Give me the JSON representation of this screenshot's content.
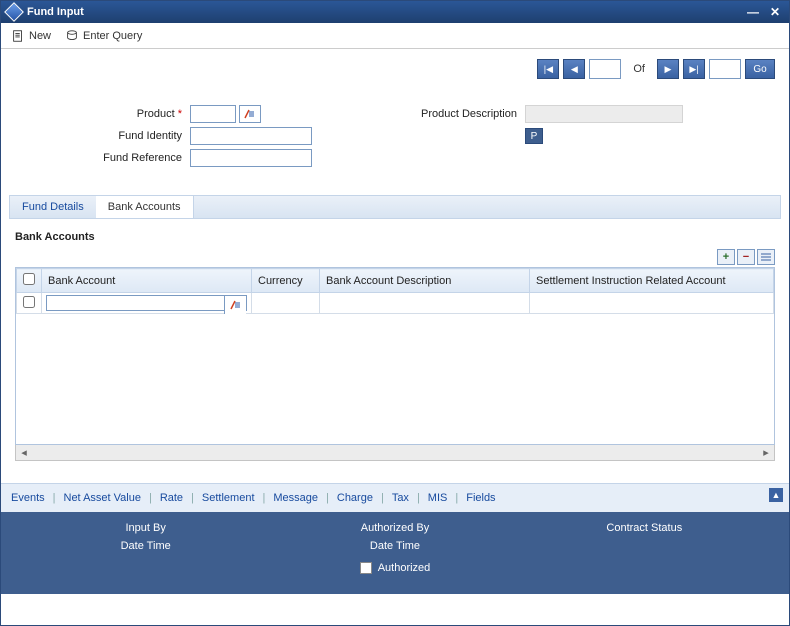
{
  "window": {
    "title": "Fund Input"
  },
  "toolbar": {
    "new": "New",
    "enterQuery": "Enter Query"
  },
  "nav": {
    "of": "Of",
    "go": "Go"
  },
  "form": {
    "productLabel": "Product",
    "fundIdentityLabel": "Fund Identity",
    "fundReferenceLabel": "Fund Reference",
    "productDescLabel": "Product Description",
    "pBtn": "P"
  },
  "tabs": {
    "fundDetails": "Fund Details",
    "bankAccounts": "Bank Accounts"
  },
  "section": {
    "bankAccountsHeader": "Bank Accounts"
  },
  "tableHeaders": {
    "bankAccount": "Bank Account",
    "currency": "Currency",
    "bankAccountDesc": "Bank Account Description",
    "settlement": "Settlement Instruction Related Account"
  },
  "bottomLinks": [
    "Events",
    "Net Asset Value",
    "Rate",
    "Settlement",
    "Message",
    "Charge",
    "Tax",
    "MIS",
    "Fields"
  ],
  "audit": {
    "inputBy": "Input By",
    "dateTime": "Date Time",
    "authBy": "Authorized By",
    "contractStatus": "Contract Status",
    "authorized": "Authorized"
  }
}
